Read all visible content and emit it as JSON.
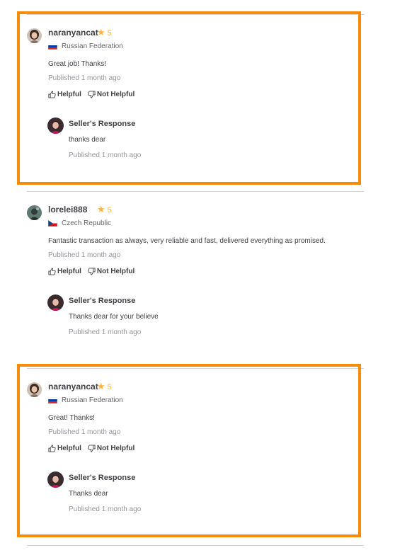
{
  "reviews": [
    {
      "username": "naranyancat",
      "rating": "5",
      "country": "Russian Federation",
      "flag_colors": [
        "#ffffff",
        "#0039a6",
        "#d52b1e"
      ],
      "text": "Great job! Thanks!",
      "published": "Published 1 month ago",
      "helpful_label": "Helpful",
      "not_helpful_label": "Not Helpful",
      "seller_response_title": "Seller's Response",
      "seller_response_text": "thanks dear",
      "seller_response_published": "Published 1 month ago"
    },
    {
      "username": "lorelei888",
      "rating": "5",
      "country": "Czech Republic",
      "flag_colors": [
        "#ffffff",
        "#d7141a",
        "#11457e"
      ],
      "text": "Fantastic transaction as always, very reliable and fast, delivered everything as promised.",
      "published": "Published 1 month ago",
      "helpful_label": "Helpful",
      "not_helpful_label": "Not Helpful",
      "seller_response_title": "Seller's Response",
      "seller_response_text": "Thanks dear for your believe",
      "seller_response_published": "Published 1 month ago"
    },
    {
      "username": "naranyancat",
      "rating": "5",
      "country": "Russian Federation",
      "flag_colors": [
        "#ffffff",
        "#0039a6",
        "#d52b1e"
      ],
      "text": "Great! Thanks!",
      "published": "Published 1 month ago",
      "helpful_label": "Helpful",
      "not_helpful_label": "Not Helpful",
      "seller_response_title": "Seller's Response",
      "seller_response_text": "Thanks dear",
      "seller_response_published": "Published 1 month ago"
    }
  ],
  "colors": {
    "highlight": "#f78c0a",
    "star": "#ffb33e",
    "muted_text": "#95979d",
    "primary_text": "#404145"
  },
  "icons": {
    "star": "star-icon",
    "helpful": "thumbs-up-icon",
    "not_helpful": "thumbs-down-icon"
  }
}
